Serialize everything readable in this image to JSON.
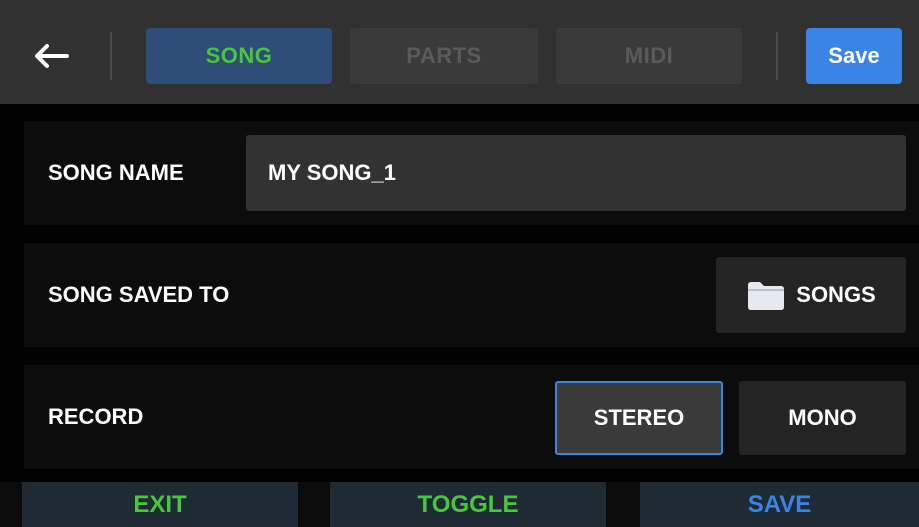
{
  "header": {
    "tabs": [
      {
        "label": "SONG",
        "active": true
      },
      {
        "label": "PARTS",
        "active": false
      },
      {
        "label": "MIDI",
        "active": false
      }
    ],
    "save_label": "Save"
  },
  "song_name": {
    "label": "SONG NAME",
    "value": "MY SONG_1"
  },
  "saved_to": {
    "label": "SONG SAVED TO",
    "folder": "SONGS",
    "icon": "folder-icon"
  },
  "record": {
    "label": "RECORD",
    "options": [
      "STEREO",
      "MONO"
    ],
    "selected": "STEREO"
  },
  "softkeys": {
    "left": "EXIT",
    "center": "TOGGLE",
    "right": "SAVE"
  },
  "colors": {
    "active_tab_text": "#46c83a",
    "accent_blue": "#3a84e6",
    "active_tab_bg": "#2e4e78"
  }
}
